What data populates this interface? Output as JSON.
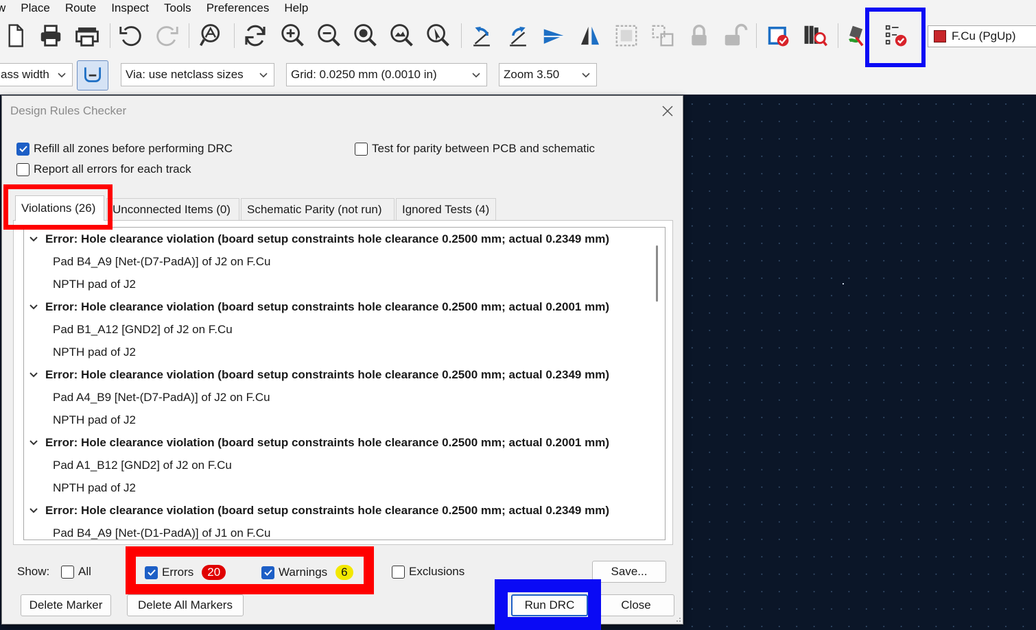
{
  "menu": [
    "w",
    "Place",
    "Route",
    "Inspect",
    "Tools",
    "Preferences",
    "Help"
  ],
  "toolbar": {
    "icons": [
      "new-board-icon",
      "print-icon",
      "plot-icon",
      "undo-icon",
      "redo-icon",
      "find-icon",
      "refresh-icon",
      "zoom-in-icon",
      "zoom-out-icon",
      "zoom-fit-icon",
      "zoom-objects-icon",
      "zoom-selection-icon",
      "rotate-ccw-icon",
      "rotate-cw-icon",
      "flip-icon",
      "mirror-icon",
      "group-icon",
      "ungroup-icon",
      "lock-icon",
      "unlock-icon",
      "update-pcb-icon",
      "footprint-browser-icon",
      "scripting-icon",
      "drc-icon"
    ],
    "layer": "F.Cu (PgUp)",
    "layer_color": "#c8262b"
  },
  "toolbar2": {
    "track_width": "ass width",
    "via_size": "Via: use netclass sizes",
    "grid": "Grid: 0.0250 mm (0.0010 in)",
    "zoom": "Zoom 3.50"
  },
  "dialog": {
    "title": "Design Rules Checker",
    "options": {
      "refill_zones": {
        "label": "Refill all zones before performing DRC",
        "checked": true
      },
      "report_all_track_errors": {
        "label": "Report all errors for each track",
        "checked": false
      },
      "test_parity": {
        "label": "Test for parity between PCB and schematic",
        "checked": false
      }
    },
    "tabs": [
      {
        "label": "Violations (26)",
        "active": true
      },
      {
        "label": "Unconnected Items (0)",
        "active": false
      },
      {
        "label": "Schematic Parity (not run)",
        "active": false
      },
      {
        "label": "Ignored Tests (4)",
        "active": false
      }
    ],
    "violations": [
      {
        "error": "Error: Hole clearance violation (board setup constraints hole clearance 0.2500 mm; actual 0.2349 mm)",
        "items": [
          "Pad B4_A9 [Net-(D7-PadA)] of J2 on F.Cu",
          "NPTH pad of J2"
        ]
      },
      {
        "error": "Error: Hole clearance violation (board setup constraints hole clearance 0.2500 mm; actual 0.2001 mm)",
        "items": [
          "Pad B1_A12 [GND2] of J2 on F.Cu",
          "NPTH pad of J2"
        ]
      },
      {
        "error": "Error: Hole clearance violation (board setup constraints hole clearance 0.2500 mm; actual 0.2349 mm)",
        "items": [
          "Pad A4_B9 [Net-(D7-PadA)] of J2 on F.Cu",
          "NPTH pad of J2"
        ]
      },
      {
        "error": "Error: Hole clearance violation (board setup constraints hole clearance 0.2500 mm; actual 0.2001 mm)",
        "items": [
          "Pad A1_B12 [GND2] of J2 on F.Cu",
          "NPTH pad of J2"
        ]
      },
      {
        "error": "Error: Hole clearance violation (board setup constraints hole clearance 0.2500 mm; actual 0.2349 mm)",
        "items": [
          "Pad B4_A9 [Net-(D1-PadA)] of J1 on F.Cu"
        ]
      }
    ],
    "show": {
      "label": "Show:",
      "all": {
        "label": "All",
        "checked": false
      },
      "errors": {
        "label": "Errors",
        "checked": true,
        "count": "20"
      },
      "warnings": {
        "label": "Warnings",
        "checked": true,
        "count": "6"
      },
      "exclusions": {
        "label": "Exclusions",
        "checked": false
      }
    },
    "buttons": {
      "save": "Save...",
      "delete_marker": "Delete Marker",
      "delete_all_markers": "Delete All Markers",
      "run_drc": "Run DRC",
      "close": "Close"
    }
  }
}
